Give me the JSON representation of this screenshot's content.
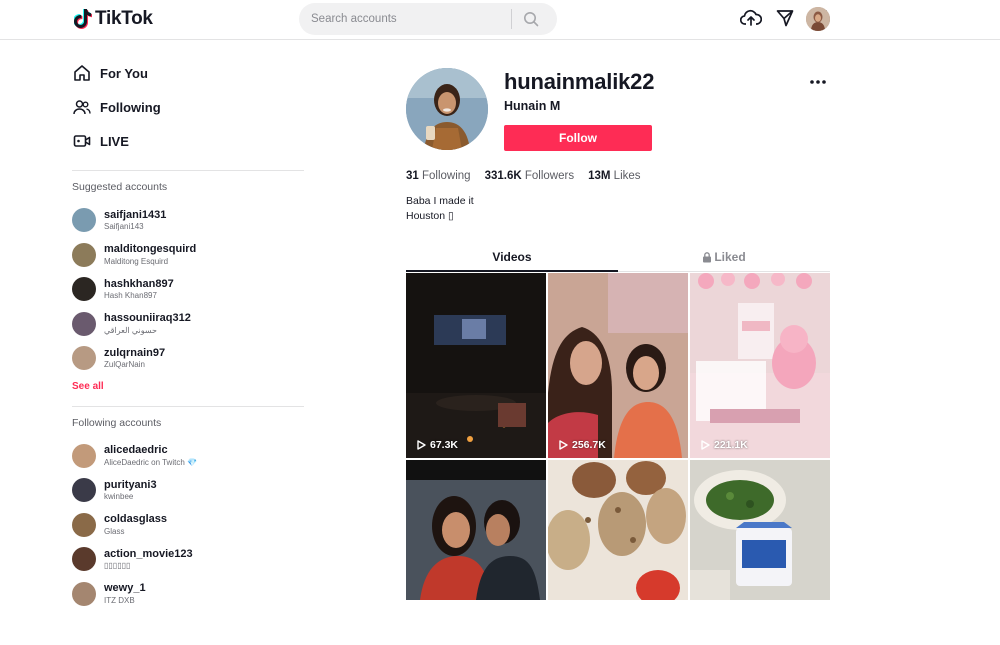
{
  "header": {
    "logo_text": "TikTok",
    "search_placeholder": "Search accounts"
  },
  "nav": [
    {
      "label": "For You",
      "icon": "home-icon"
    },
    {
      "label": "Following",
      "icon": "users-icon"
    },
    {
      "label": "LIVE",
      "icon": "live-icon"
    }
  ],
  "suggested": {
    "title": "Suggested accounts",
    "see_all": "See all",
    "accounts": [
      {
        "user": "saifjani1431",
        "name": "Saifjani143",
        "color": "#7a9bb0"
      },
      {
        "user": "malditongesquird",
        "name": "Malditong Esquird",
        "color": "#8c7b5a"
      },
      {
        "user": "hashkhan897",
        "name": "Hash Khan897",
        "color": "#2b2622"
      },
      {
        "user": "hassouniiraq312",
        "name": "حسوني العراقي",
        "color": "#6a5a6e"
      },
      {
        "user": "zulqrnain97",
        "name": "ZulQarNain",
        "color": "#b79a83"
      }
    ]
  },
  "following_accounts": {
    "title": "Following accounts",
    "accounts": [
      {
        "user": "alicedaedric",
        "name": "AliceDaedric on Twitch 💎",
        "color": "#c29a7a"
      },
      {
        "user": "purityani3",
        "name": "kwinbee",
        "color": "#3a3a48"
      },
      {
        "user": "coldasglass",
        "name": "Glass",
        "color": "#8a6a48"
      },
      {
        "user": "action_movie123",
        "name": "▯▯▯▯▯▯",
        "color": "#5a3a2c"
      },
      {
        "user": "wewy_1",
        "name": "ITZ DXB",
        "color": "#a48670"
      }
    ]
  },
  "profile": {
    "username": "hunainmalik22",
    "display_name": "Hunain M",
    "follow_label": "Follow",
    "stats": [
      {
        "value": "31",
        "label": "Following"
      },
      {
        "value": "331.6K",
        "label": "Followers"
      },
      {
        "value": "13M",
        "label": "Likes"
      }
    ],
    "bio_line1": "Baba I made it",
    "bio_line2": "Houston ▯"
  },
  "tabs": [
    {
      "label": "Videos",
      "active": true
    },
    {
      "label": "Liked",
      "active": false
    }
  ],
  "videos": [
    {
      "views": "67.3K",
      "bg": "#1a1614"
    },
    {
      "views": "256.7K",
      "bg": "#b8897a"
    },
    {
      "views": "221.1K",
      "bg": "#e8c8cc"
    },
    {
      "views": "",
      "bg": "#3a4048"
    },
    {
      "views": "",
      "bg": "#d8c8b4"
    },
    {
      "views": "",
      "bg": "#c8c8c0"
    }
  ]
}
